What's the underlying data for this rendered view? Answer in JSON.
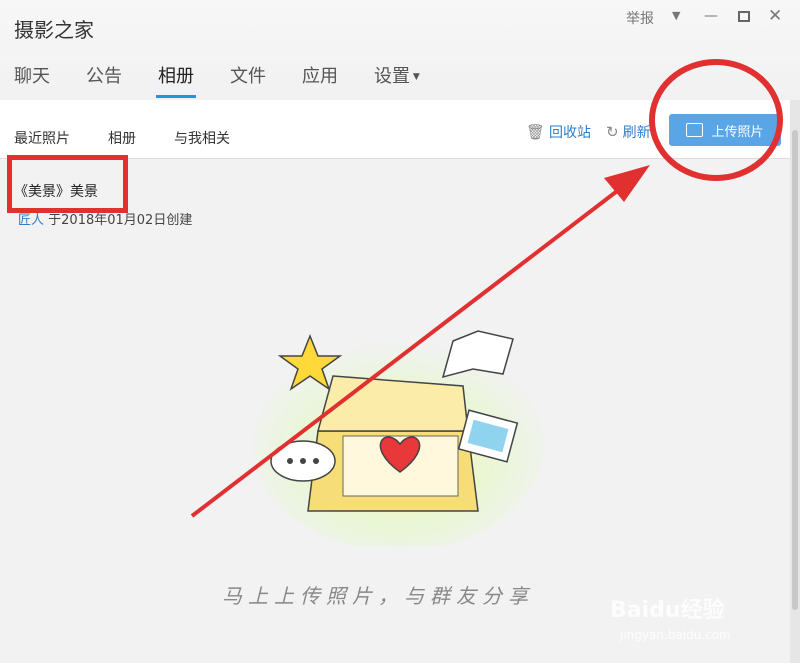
{
  "window": {
    "title": "摄影之家",
    "report": "举报"
  },
  "tabs": [
    {
      "label": "聊天"
    },
    {
      "label": "公告"
    },
    {
      "label": "相册"
    },
    {
      "label": "文件"
    },
    {
      "label": "应用"
    },
    {
      "label": "设置"
    }
  ],
  "subnav": {
    "recent": "最近照片",
    "albums": "相册",
    "related": "与我相关"
  },
  "actions": {
    "recycle": "回收站",
    "refresh": "刷新",
    "upload": "上传照片"
  },
  "album": {
    "title": "《美景》美景",
    "user": "匠人",
    "meta": "于2018年01月02日创建"
  },
  "empty_state": {
    "slogan": "马上上传照片，与群友分享"
  },
  "watermark": {
    "brand": "Baidu经验",
    "url": "jingyan.baidu.com"
  },
  "colors": {
    "accent": "#1e95e0",
    "upload_button": "#5aa5e6",
    "annotation": "#e03030"
  }
}
